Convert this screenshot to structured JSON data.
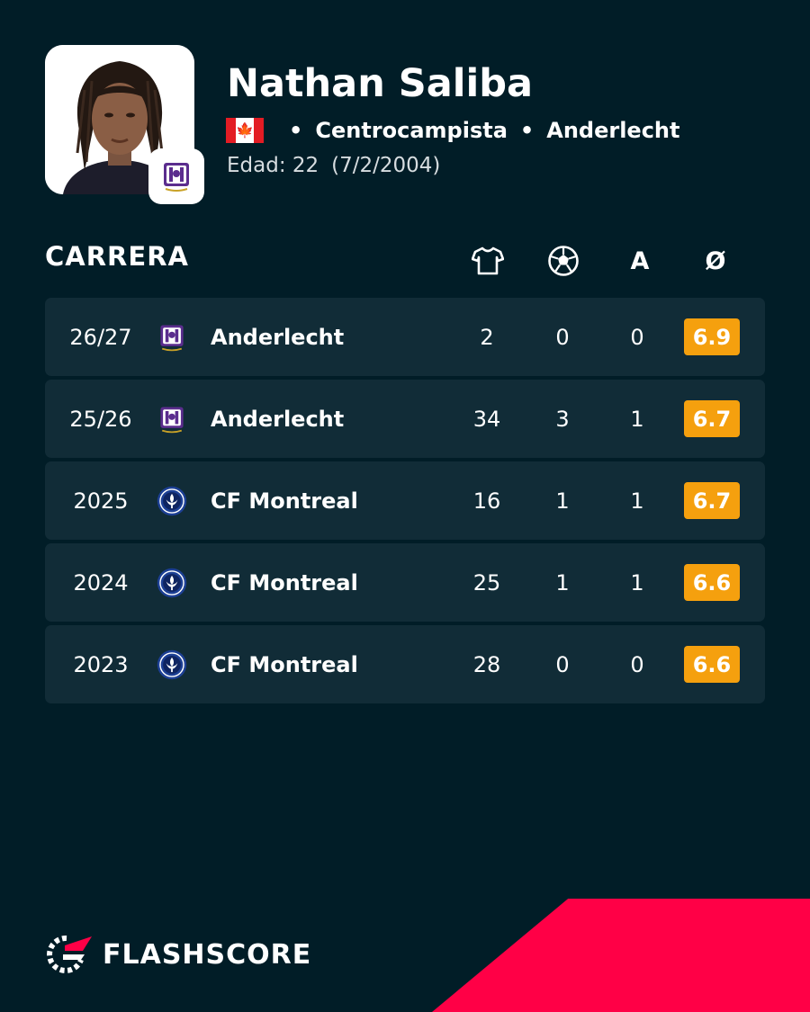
{
  "player": {
    "name": "Nathan Saliba",
    "country_flag": "flag-canada",
    "position": "Centrocampista",
    "club": "Anderlecht",
    "age_label": "Edad: 22",
    "birth_date": "(7/2/2004)"
  },
  "career": {
    "title": "CARRERA",
    "columns": [
      {
        "icon": "shirt-icon",
        "label": ""
      },
      {
        "icon": "football-icon",
        "label": ""
      },
      {
        "icon": "assists-column",
        "label": "A"
      },
      {
        "icon": "average-rating-icon",
        "label": "Ø"
      }
    ],
    "rows": [
      {
        "season": "26/27",
        "club": "Anderlecht",
        "club_logo": "anderlecht-logo-icon",
        "matches": "2",
        "goals": "0",
        "assists": "0",
        "rating": "6.9"
      },
      {
        "season": "25/26",
        "club": "Anderlecht",
        "club_logo": "anderlecht-logo-icon",
        "matches": "34",
        "goals": "3",
        "assists": "1",
        "rating": "6.7"
      },
      {
        "season": "2025",
        "club": "CF Montreal",
        "club_logo": "cf-montreal-logo-icon",
        "matches": "16",
        "goals": "1",
        "assists": "1",
        "rating": "6.7"
      },
      {
        "season": "2024",
        "club": "CF Montreal",
        "club_logo": "cf-montreal-logo-icon",
        "matches": "25",
        "goals": "1",
        "assists": "1",
        "rating": "6.6"
      },
      {
        "season": "2023",
        "club": "CF Montreal",
        "club_logo": "cf-montreal-logo-icon",
        "matches": "28",
        "goals": "0",
        "assists": "0",
        "rating": "6.6"
      }
    ]
  },
  "brand": {
    "name": "FLASHSCORE"
  },
  "colors": {
    "background": "#011d27",
    "row": "#112c37",
    "rating": "#f5a00e",
    "brand_accent": "#ff0046",
    "anderlecht": "#5b2d8e",
    "montreal": "#1c3f94"
  }
}
